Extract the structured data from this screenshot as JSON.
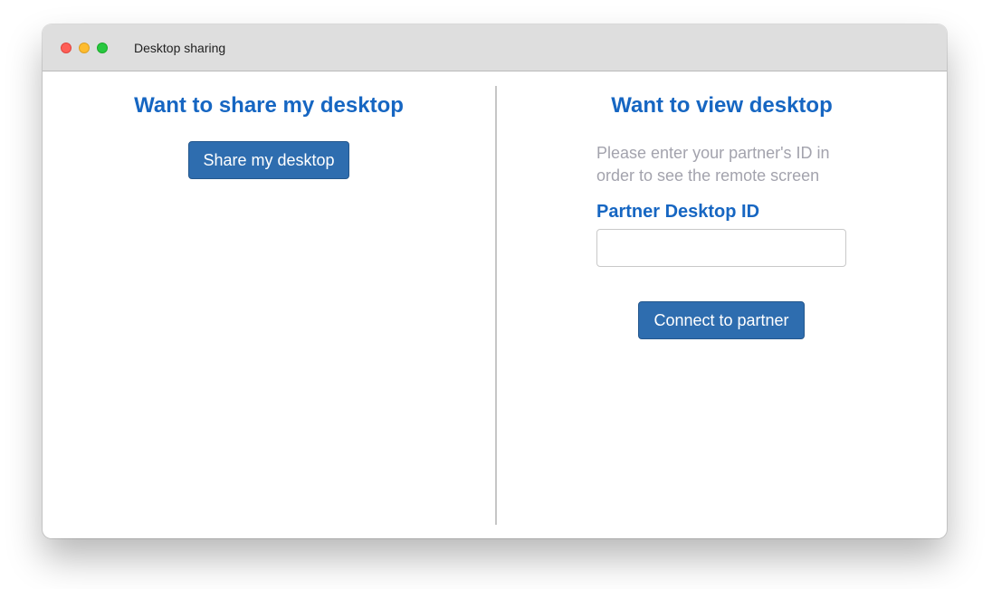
{
  "window": {
    "title": "Desktop sharing"
  },
  "share_pane": {
    "heading": "Want to share my desktop",
    "share_button_label": "Share my desktop"
  },
  "view_pane": {
    "heading": "Want to view desktop",
    "hint": "Please enter your partner's ID in order to see the remote screen",
    "id_label": "Partner Desktop ID",
    "id_value": "",
    "connect_button_label": "Connect to partner"
  },
  "colors": {
    "accent": "#1666c2",
    "button": "#2e6daf",
    "hint_text": "#a3a3ad"
  }
}
